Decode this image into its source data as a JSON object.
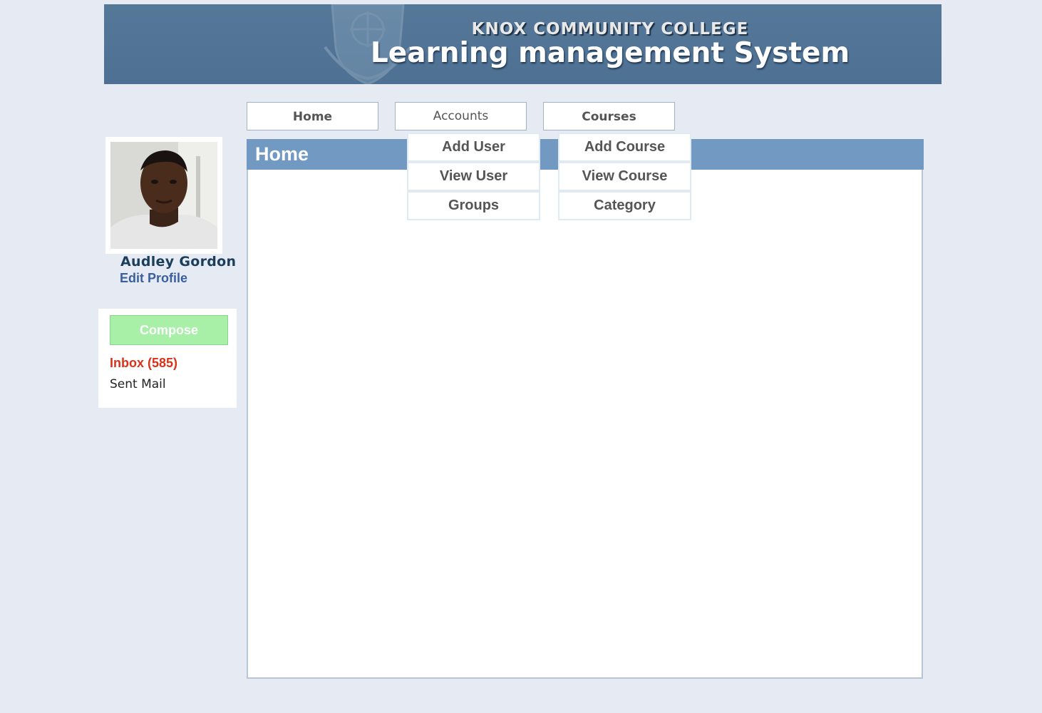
{
  "header": {
    "college_name": "KNOX COMMUNITY COLLEGE",
    "system_title": "Learning management System"
  },
  "nav": {
    "home_label": "Home",
    "accounts_label": "Accounts",
    "courses_label": "Courses",
    "accounts_menu": [
      "Add User",
      "View User",
      "Groups"
    ],
    "courses_menu": [
      "Add Course",
      "View Course",
      "Category"
    ]
  },
  "content": {
    "title": "Home"
  },
  "profile": {
    "name": "Audley Gordon",
    "edit_label": "Edit Profile"
  },
  "mail": {
    "compose_label": "Compose",
    "inbox_label": "Inbox (585)",
    "sent_label": "Sent Mail"
  },
  "colors": {
    "banner": "#557899",
    "content_header": "#7299c2",
    "compose": "#a8f0a8",
    "inbox": "#d9321a",
    "page_background": "#e6ebf3"
  }
}
